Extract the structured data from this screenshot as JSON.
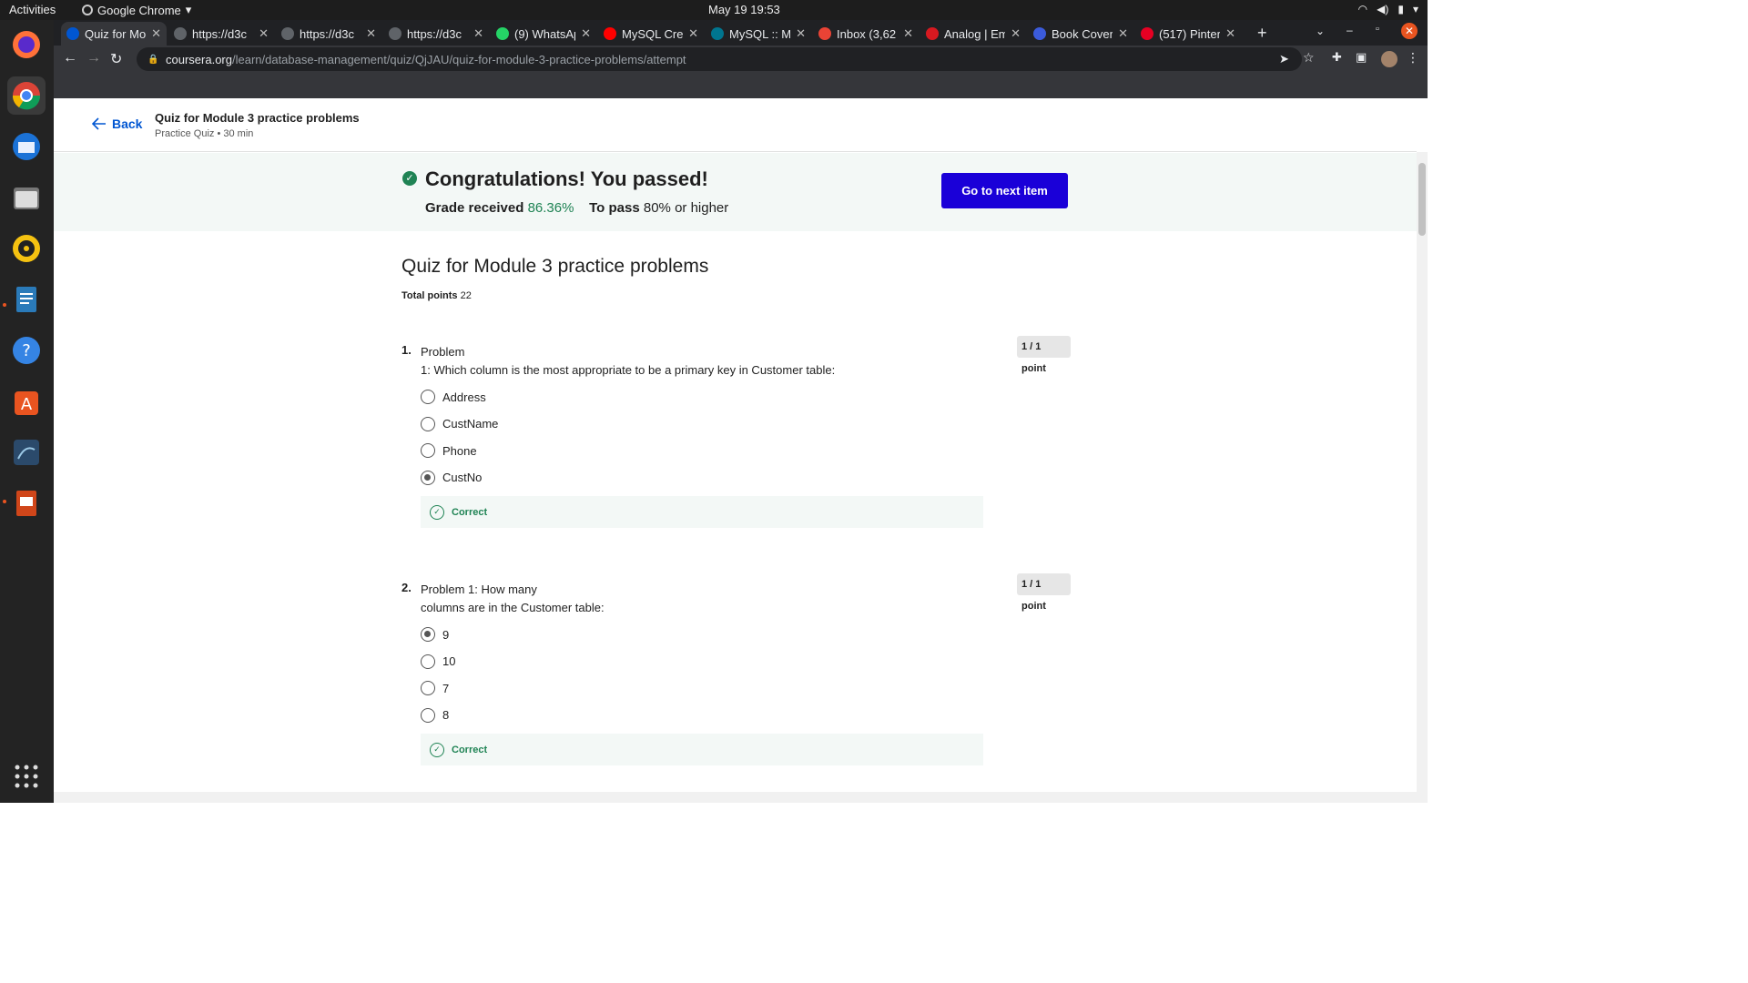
{
  "system": {
    "activities": "Activities",
    "app_name": "Google Chrome",
    "clock": "May 19  19:53"
  },
  "browser": {
    "tabs": [
      {
        "title": "Quiz for Mo",
        "icon": "coursera-icon",
        "color": "#0056d2"
      },
      {
        "title": "https://d3c",
        "icon": "globe-icon",
        "color": "#5f6368"
      },
      {
        "title": "https://d3c",
        "icon": "globe-icon",
        "color": "#5f6368"
      },
      {
        "title": "https://d3c",
        "icon": "globe-icon",
        "color": "#5f6368"
      },
      {
        "title": "(9) WhatsAp",
        "icon": "whatsapp-icon",
        "color": "#25d366"
      },
      {
        "title": "MySQL Crea",
        "icon": "youtube-icon",
        "color": "#ff0000"
      },
      {
        "title": "MySQL :: My",
        "icon": "mysql-icon",
        "color": "#00758f"
      },
      {
        "title": "Inbox (3,62",
        "icon": "gmail-icon",
        "color": "#ea4335"
      },
      {
        "title": "Analog | Em",
        "icon": "analog-icon",
        "color": "#d71920"
      },
      {
        "title": "Book Cover",
        "icon": "book-icon",
        "color": "#3b5bdb"
      },
      {
        "title": "(517) Pinter",
        "icon": "pinterest-icon",
        "color": "#e60023"
      }
    ],
    "url_host": "coursera.org",
    "url_path": "/learn/database-management/quiz/QjJAU/quiz-for-module-3-practice-problems/attempt"
  },
  "header": {
    "back_label": "Back",
    "title": "Quiz for Module 3 practice problems",
    "subtitle": "Practice Quiz • 30 min"
  },
  "banner": {
    "headline": "Congratulations! You passed!",
    "grade_label": "Grade received",
    "grade_value": "86.36%",
    "pass_label": "To pass",
    "pass_value": "80% or higher",
    "next_button": "Go to next item"
  },
  "quiz": {
    "title": "Quiz for Module 3 practice problems",
    "total_label": "Total points",
    "total_value": "22",
    "questions": [
      {
        "number": "1.",
        "line1": "Problem",
        "line2": "1: Which column is the most appropriate to be a primary key in Customer table:",
        "points": "1 / 1 point",
        "options": [
          "Address",
          "CustName",
          "Phone",
          "CustNo"
        ],
        "selected": 3,
        "feedback": "Correct"
      },
      {
        "number": "2.",
        "line1": "Problem 1: How many",
        "line2": "columns are in the Customer table:",
        "points": "1 / 1 point",
        "options": [
          "9",
          "10",
          "7",
          "8"
        ],
        "selected": 0,
        "feedback": "Correct"
      }
    ]
  },
  "colors": {
    "accent": "#0056d2",
    "primary_button": "#1a00d8",
    "success": "#1f8354"
  }
}
